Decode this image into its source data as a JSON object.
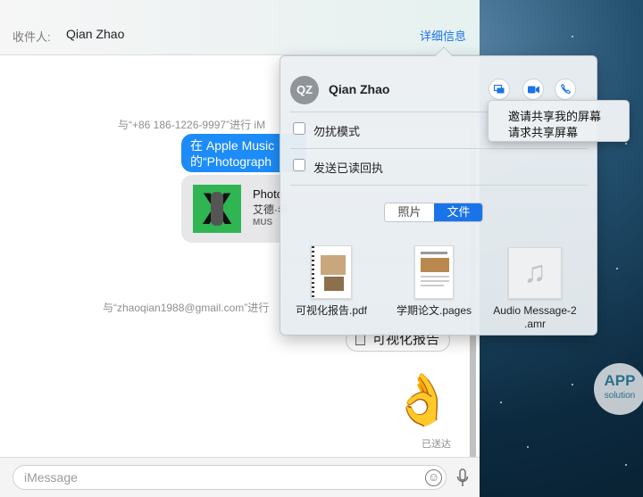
{
  "header": {
    "to_label": "收件人:",
    "recipient": "Qian Zhao",
    "details_label": "详细信息"
  },
  "conversation": {
    "system_line_1": "与“+86 186-1226-9997”进行 iM",
    "bubble_line_1": "在 Apple Music",
    "bubble_line_2": "的“Photograph",
    "music_card": {
      "title": "Photo",
      "artist": "艾德·希",
      "brand": "MUS"
    },
    "system_line_2": "与“zhaoqian1988@gmail.com”进行",
    "file_bubble": "可视化报告",
    "emoji": "👌",
    "status": "已送达"
  },
  "composer": {
    "placeholder": "iMessage"
  },
  "details_popover": {
    "avatar_initials": "QZ",
    "contact_name": "Qian Zhao",
    "dnd_label": "勿扰模式",
    "read_receipt_label": "发送已读回执",
    "tab_photos": "照片",
    "tab_files": "文件",
    "files": [
      {
        "name_line1": "可视化报告.pdf",
        "name_line2": ""
      },
      {
        "name_line1": "学期论文.pages",
        "name_line2": ""
      },
      {
        "name_line1": "Audio Message-2",
        "name_line2": ".amr"
      }
    ]
  },
  "share_menu": {
    "item_1": "邀请共享我的屏幕",
    "item_2": "请求共享屏幕"
  },
  "watermark": {
    "line1": "APP",
    "line2": "solution"
  },
  "colors": {
    "accent": "#1a73e8",
    "bubble_blue": "#1d8cf8",
    "album_green": "#2fb551"
  }
}
